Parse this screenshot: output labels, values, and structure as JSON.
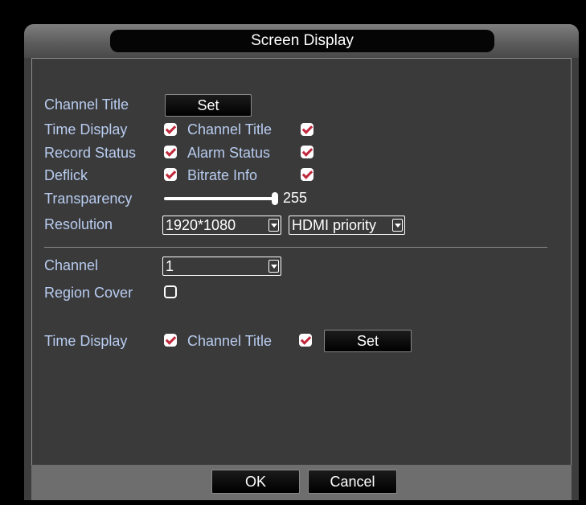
{
  "dialog": {
    "title": "Screen Display",
    "ok_label": "OK",
    "cancel_label": "Cancel"
  },
  "osd": {
    "channel_title_label": "Channel Title",
    "set_label": "Set",
    "time_display_label": "Time Display",
    "time_display_checked": true,
    "channel_title_check_label": "Channel Title",
    "channel_title_checked": true,
    "record_status_label": "Record Status",
    "record_status_checked": true,
    "alarm_status_label": "Alarm Status",
    "alarm_status_checked": true,
    "deflick_label": "Deflick",
    "deflick_checked": true,
    "bitrate_info_label": "Bitrate Info",
    "bitrate_info_checked": true,
    "transparency_label": "Transparency",
    "transparency_value": "255",
    "transparency_max": 255,
    "resolution_label": "Resolution",
    "resolution_value": "1920*1080",
    "output_priority_value": "HDMI priority"
  },
  "channel_settings": {
    "channel_label": "Channel",
    "channel_value": "1",
    "region_cover_label": "Region Cover",
    "region_cover_checked": false,
    "time_display_label": "Time Display",
    "time_display_checked": true,
    "channel_title_label": "Channel Title",
    "channel_title_checked": true,
    "set_label": "Set"
  },
  "colors": {
    "label_blue": "#b8ccf0",
    "checkmark_red": "#c0283c",
    "panel_gray": "#3a3a3a"
  }
}
